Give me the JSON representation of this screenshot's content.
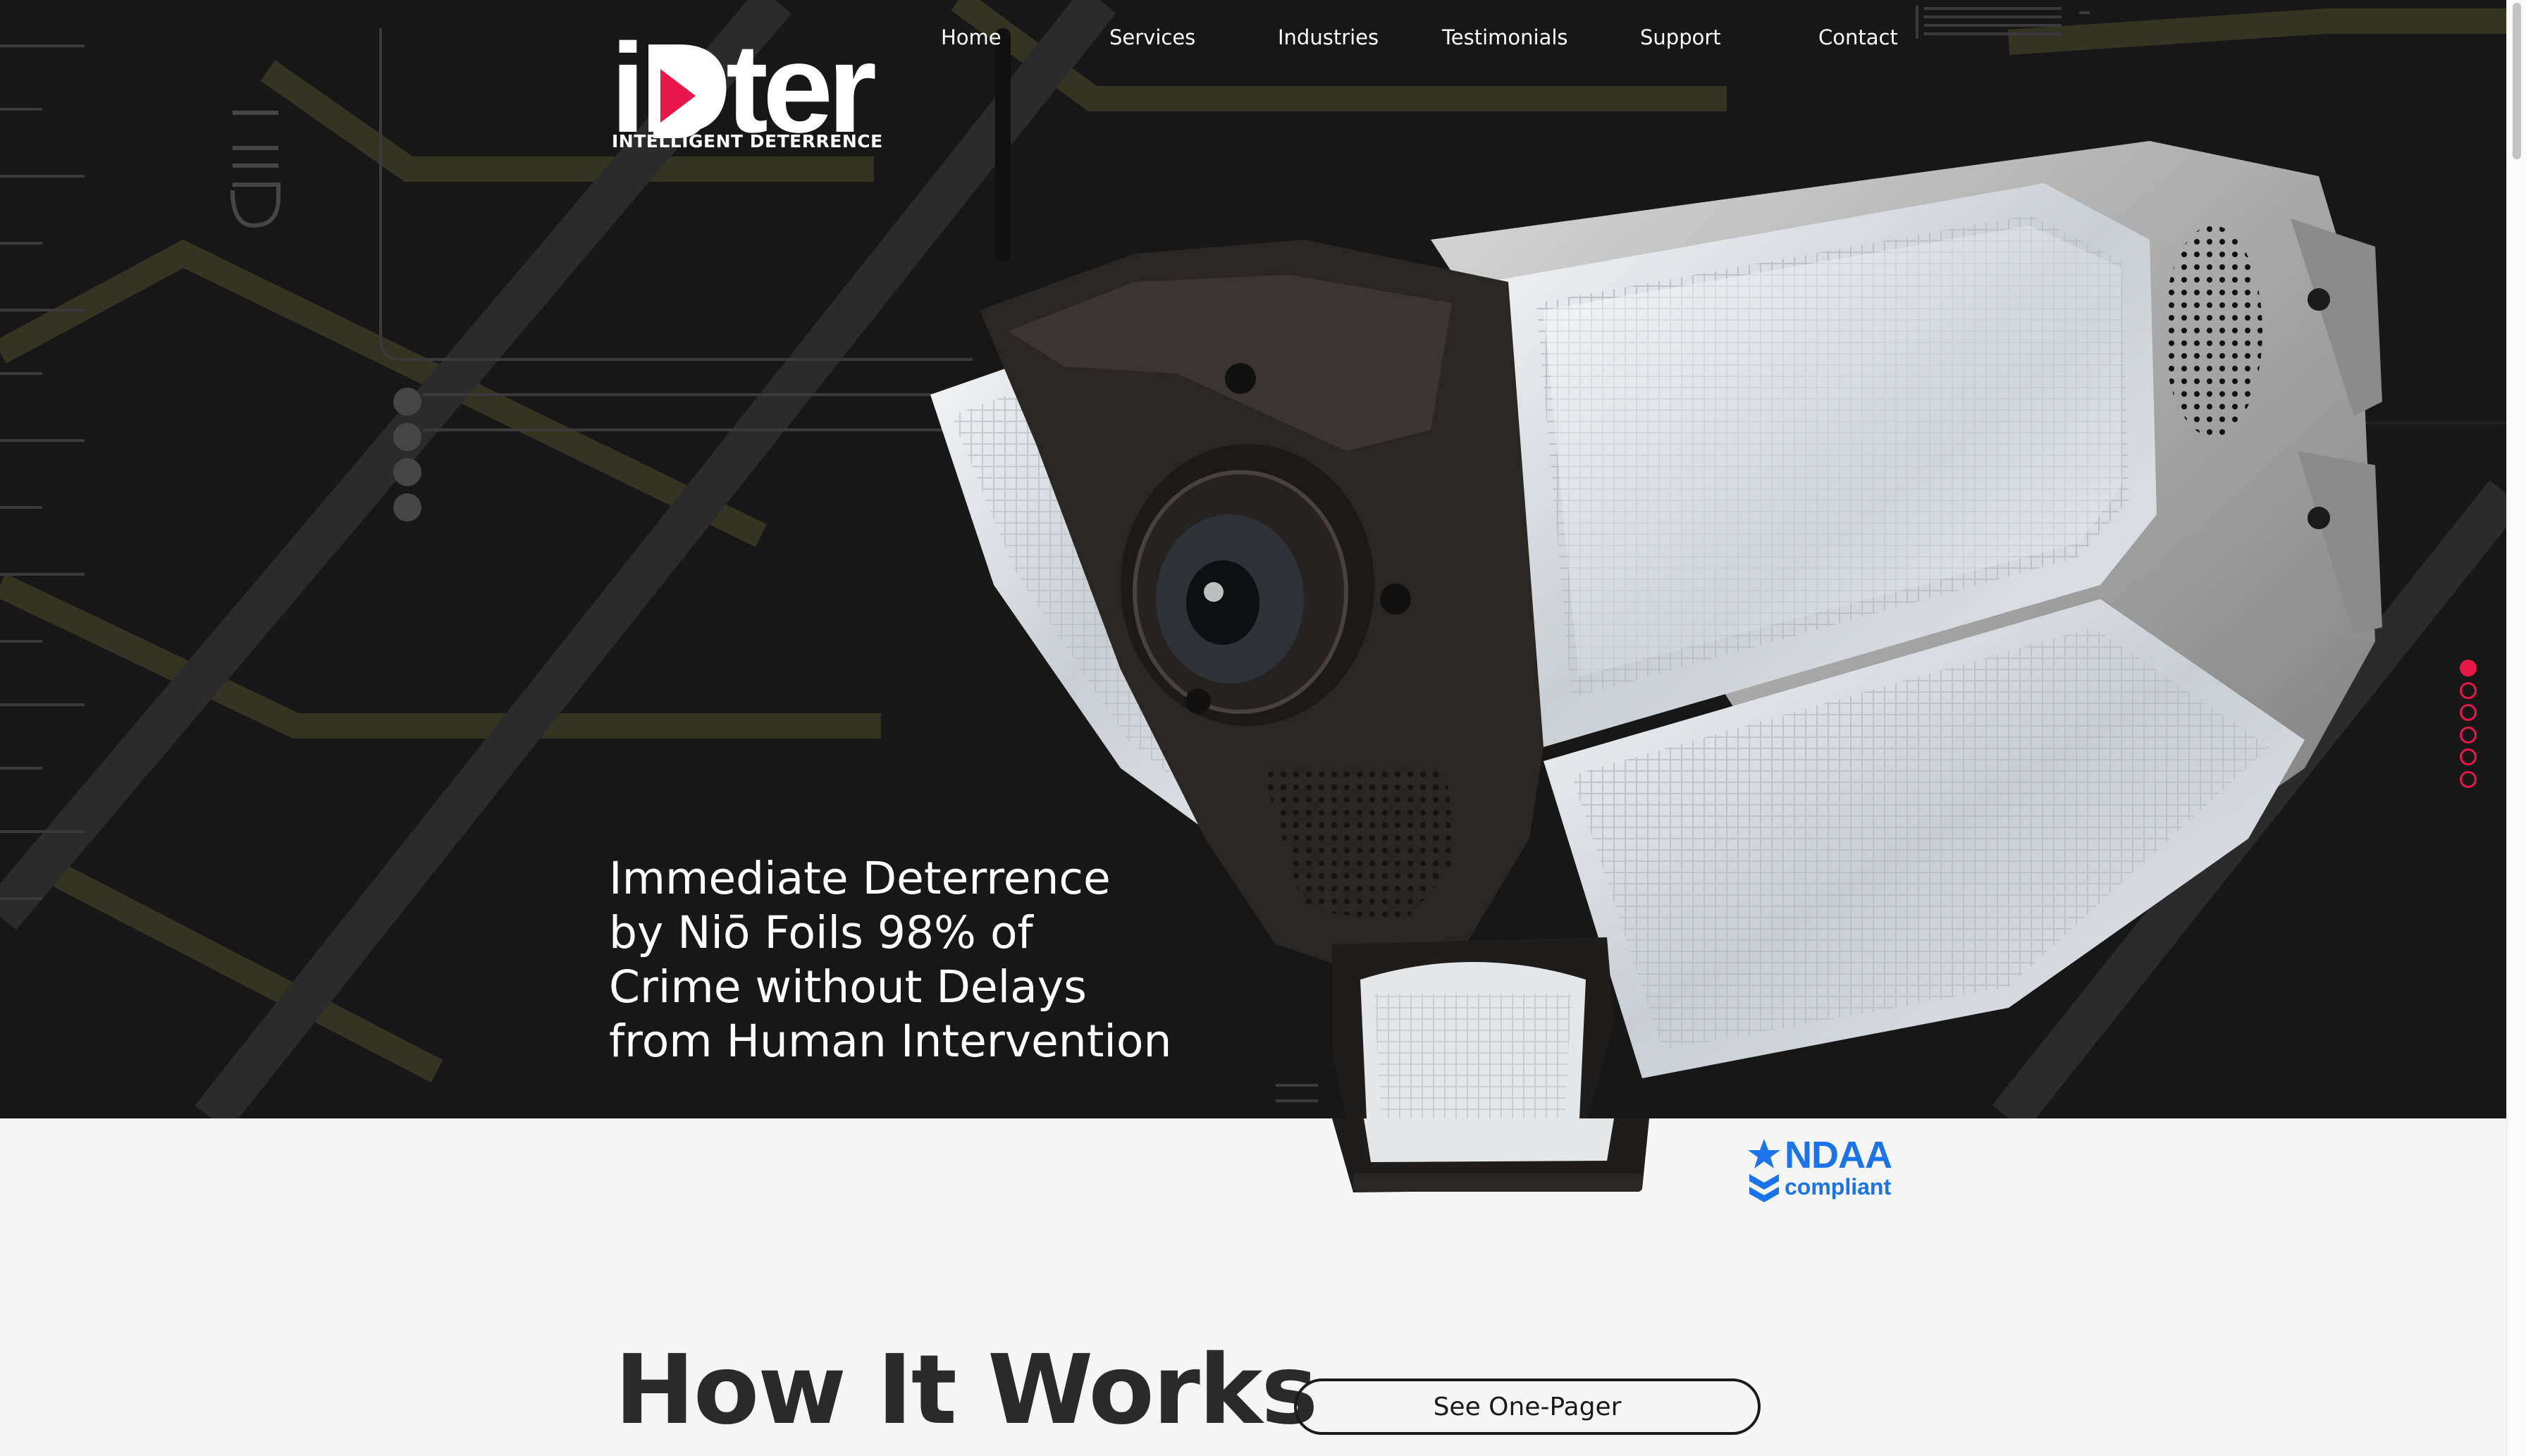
{
  "brand": {
    "logo_text": "iDter",
    "tagline": "INTELLIGENT DETERRENCE",
    "accent_color": "#e8174a"
  },
  "nav": {
    "items": [
      {
        "label": "Home"
      },
      {
        "label": "Services"
      },
      {
        "label": "Industries"
      },
      {
        "label": "Testimonials"
      },
      {
        "label": "Support"
      },
      {
        "label": "Contact"
      }
    ]
  },
  "hero": {
    "headline_lines": [
      "Immediate Deterrence",
      "by Niō Foils 98% of",
      "Crime without Delays",
      "from Human Intervention"
    ],
    "slide_count": 6,
    "active_slide": 1
  },
  "badge": {
    "title": "NDAA",
    "subtitle": "compliant",
    "color": "#1a73e8"
  },
  "section": {
    "title": "How It Works",
    "button_label": "See One-Pager"
  },
  "icons": {
    "badge_icon": "star-shield-icon",
    "device_image": "camera-floodlight-device"
  }
}
